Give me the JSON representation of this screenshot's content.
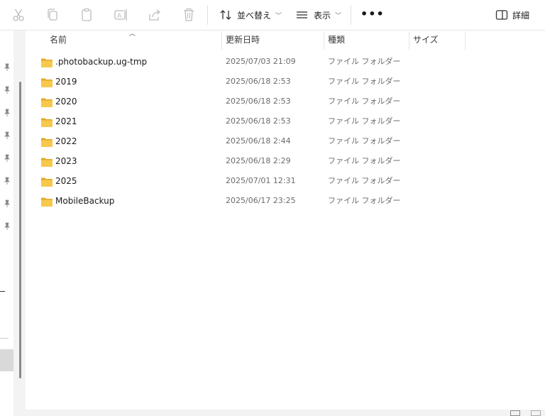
{
  "toolbar": {
    "cut_icon": "scissors-icon",
    "copy_icon": "copy-icon",
    "paste_icon": "clipboard-icon",
    "rename_icon": "rename-icon",
    "share_icon": "share-icon",
    "delete_icon": "trash-icon",
    "sort_label": "並べ替え",
    "view_label": "表示",
    "more_label": "•••",
    "details_label": "詳細"
  },
  "columns": {
    "name": "名前",
    "modified": "更新日時",
    "type": "種類",
    "size": "サイズ"
  },
  "files": [
    {
      "name": ".photobackup.ug-tmp",
      "modified": "2025/07/03 21:09",
      "type": "ファイル フォルダー"
    },
    {
      "name": "2019",
      "modified": "2025/06/18 2:53",
      "type": "ファイル フォルダー"
    },
    {
      "name": "2020",
      "modified": "2025/06/18 2:53",
      "type": "ファイル フォルダー"
    },
    {
      "name": "2021",
      "modified": "2025/06/18 2:53",
      "type": "ファイル フォルダー"
    },
    {
      "name": "2022",
      "modified": "2025/06/18 2:44",
      "type": "ファイル フォルダー"
    },
    {
      "name": "2023",
      "modified": "2025/06/18 2:29",
      "type": "ファイル フォルダー"
    },
    {
      "name": "2025",
      "modified": "2025/07/01 12:31",
      "type": "ファイル フォルダー"
    },
    {
      "name": "MobileBackup",
      "modified": "2025/06/17 23:25",
      "type": "ファイル フォルダー"
    }
  ],
  "colors": {
    "folder": "#f6c84c",
    "folder_dark": "#e3a92a",
    "disabled_icon": "#bdbdbd"
  }
}
